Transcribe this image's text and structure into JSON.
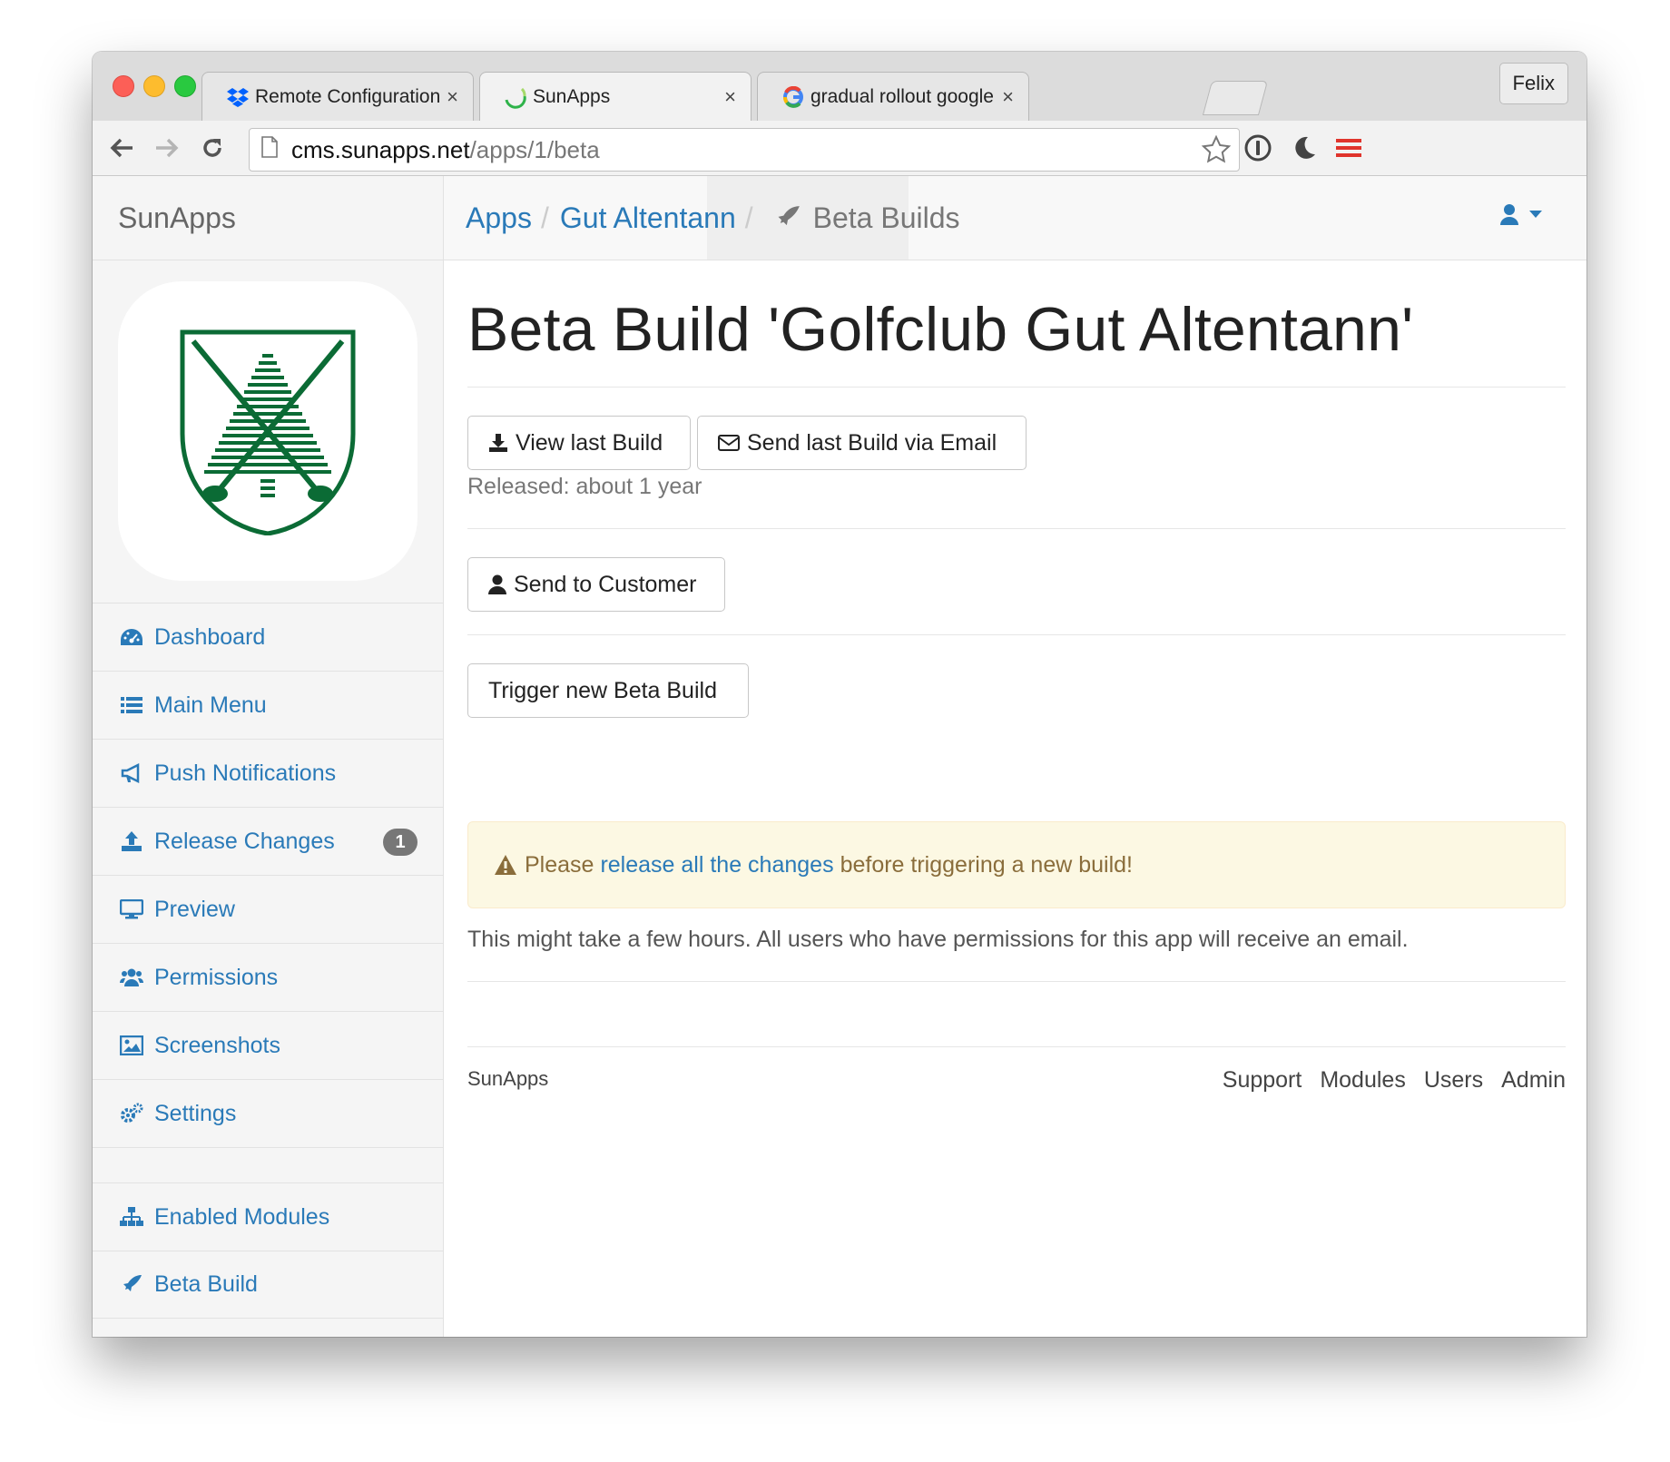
{
  "browser": {
    "tabs": [
      {
        "label": "Remote Configuration Tool",
        "icon": "dropbox-icon",
        "active": false
      },
      {
        "label": "SunApps",
        "icon": "sunapps-icon",
        "active": true
      },
      {
        "label": "gradual rollout google play",
        "icon": "google-icon",
        "active": false
      }
    ],
    "close_glyph": "×",
    "profile_name": "Felix",
    "url_host": "cms.sunapps.net",
    "url_path": "/apps/1/beta"
  },
  "sidebar": {
    "brand": "SunApps",
    "items": [
      {
        "label": "Dashboard",
        "icon": "dashboard-icon"
      },
      {
        "label": "Main Menu",
        "icon": "list-icon"
      },
      {
        "label": "Push Notifications",
        "icon": "bullhorn-icon"
      },
      {
        "label": "Release Changes",
        "icon": "upload-icon",
        "badge": "1"
      },
      {
        "label": "Preview",
        "icon": "desktop-icon"
      },
      {
        "label": "Permissions",
        "icon": "users-icon"
      },
      {
        "label": "Screenshots",
        "icon": "image-icon"
      },
      {
        "label": "Settings",
        "icon": "cogs-icon"
      }
    ],
    "items2": [
      {
        "label": "Enabled Modules",
        "icon": "sitemap-icon"
      },
      {
        "label": "Beta Build",
        "icon": "rocket-icon"
      }
    ]
  },
  "breadcrumb": {
    "apps": "Apps",
    "app": "Gut Altentann",
    "current": "Beta Builds",
    "separator": "/"
  },
  "main": {
    "title": "Beta Build 'Golfclub Gut Altentann'",
    "view_build": "View last Build",
    "send_email": "Send last Build via Email",
    "released": "Released: about 1 year",
    "send_customer": "Send to Customer",
    "trigger": "Trigger new Beta Build",
    "alert_pre": "Please",
    "alert_link": "release all the changes",
    "alert_post": "before triggering a new build!",
    "info": "This might take a few hours. All users who have permissions for this app will receive an email."
  },
  "footer": {
    "brand": "SunApps",
    "links": [
      "Support",
      "Modules",
      "Users",
      "Admin"
    ]
  },
  "colors": {
    "link": "#2a7ab8",
    "alert_bg": "#fcf8e3",
    "alert_text": "#8a6d3b",
    "logo_green": "#0b6b35",
    "badge": "#777777"
  }
}
